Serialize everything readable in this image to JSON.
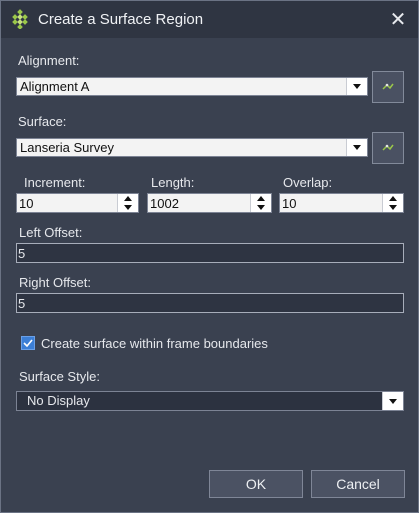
{
  "window": {
    "title": "Create a Surface Region",
    "close_glyph": "✕"
  },
  "alignment": {
    "label": "Alignment:",
    "selected": "Alignment A"
  },
  "surface": {
    "label": "Surface:",
    "selected": "Lanseria Survey"
  },
  "increment": {
    "label": "Increment:",
    "value": "10"
  },
  "length": {
    "label": "Length:",
    "value": "1002"
  },
  "overlap": {
    "label": "Overlap:",
    "value": "10"
  },
  "left_offset": {
    "label": "Left Offset:",
    "value": "5"
  },
  "right_offset": {
    "label": "Right Offset:",
    "value": "5"
  },
  "frame_boundaries": {
    "label": "Create surface within frame boundaries",
    "checked": true
  },
  "surface_style": {
    "label": "Surface Style:",
    "selected": "No Display"
  },
  "buttons": {
    "ok": "OK",
    "cancel": "Cancel"
  },
  "icons": {
    "app": "surface-region-icon",
    "pick": "pick-from-view-icon",
    "dropdown": "chevron-down-icon"
  },
  "colors": {
    "accent": "#3c7fd6",
    "app_icon": "#9bc84a",
    "background": "#3a4150"
  }
}
